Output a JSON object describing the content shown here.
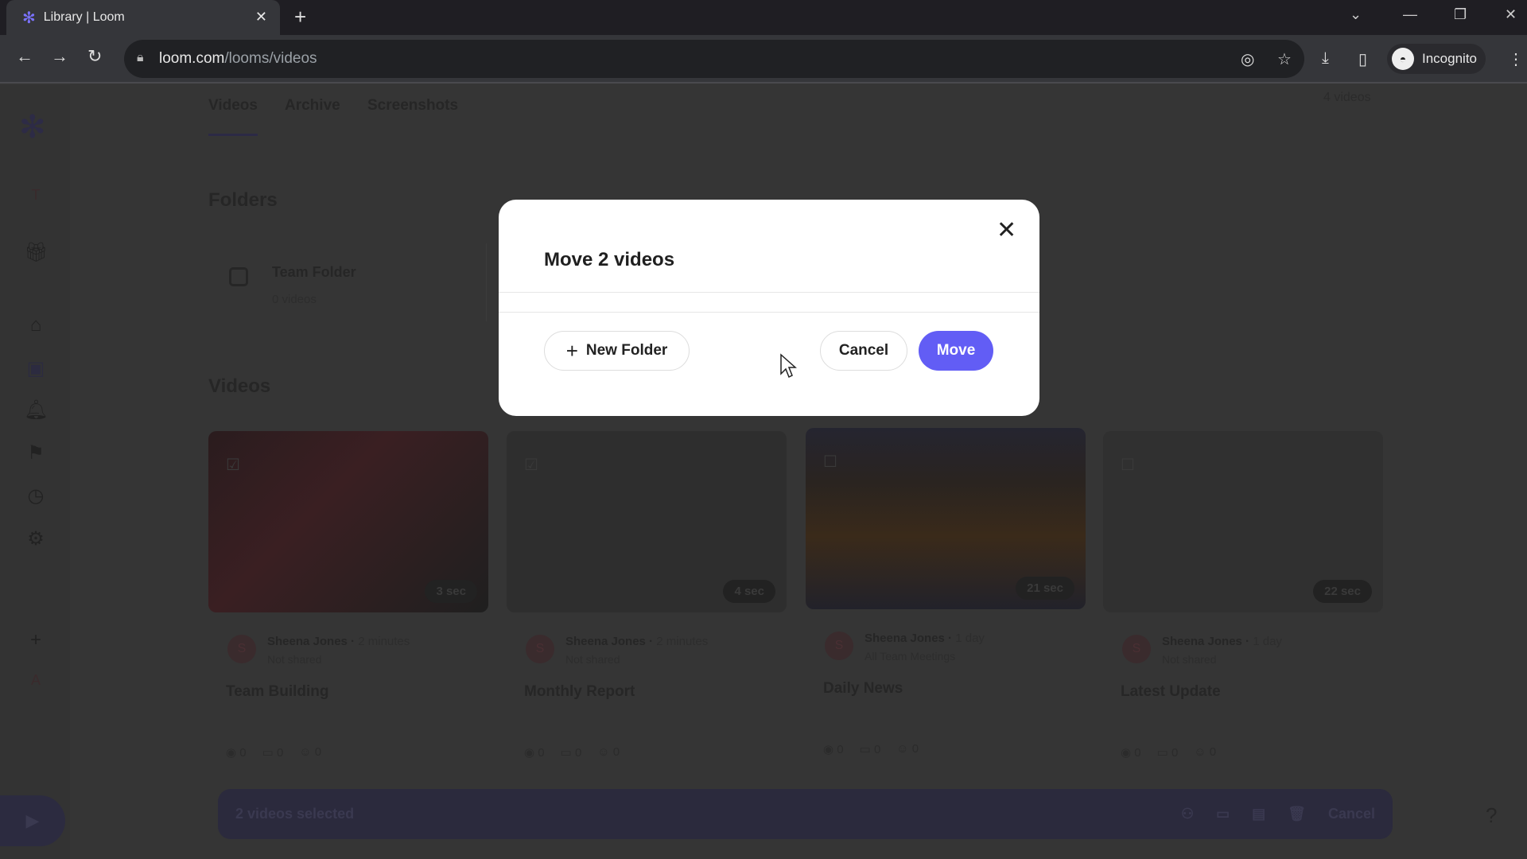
{
  "browser": {
    "tab_title": "Library | Loom",
    "url_host": "loom.com",
    "url_path": "/looms/videos",
    "profile": "Incognito"
  },
  "library": {
    "tabs": [
      "Videos",
      "Archive",
      "Screenshots"
    ],
    "video_count": "4 videos",
    "folders_heading": "Folders",
    "folder": {
      "name": "Team Folder",
      "count": "0 videos"
    },
    "videos_heading": "Videos",
    "videos": [
      {
        "title": "Team Building",
        "author": "Sheena Jones",
        "time": "2 minutes",
        "share": "Not shared",
        "duration": "3 sec",
        "views": "0",
        "comments": "0",
        "reactions": "0",
        "checked": true
      },
      {
        "title": "Monthly Report",
        "author": "Sheena Jones",
        "time": "2 minutes",
        "share": "Not shared",
        "duration": "4 sec",
        "views": "0",
        "comments": "0",
        "reactions": "0",
        "checked": true
      },
      {
        "title": "Daily News",
        "author": "Sheena Jones",
        "time": "1 day",
        "share": "All Team Meetings",
        "duration": "21 sec",
        "views": "0",
        "comments": "0",
        "reactions": "0",
        "checked": false
      },
      {
        "title": "Latest Update",
        "author": "Sheena Jones",
        "time": "1 day",
        "share": "Not shared",
        "duration": "22 sec",
        "views": "0",
        "comments": "0",
        "reactions": "0",
        "checked": false
      }
    ]
  },
  "selection_bar": {
    "label": "2 videos selected",
    "cancel": "Cancel"
  },
  "modal": {
    "title": "Move 2 videos",
    "new_folder": "New Folder",
    "cancel": "Cancel",
    "move": "Move"
  },
  "colors": {
    "accent": "#625df5"
  }
}
